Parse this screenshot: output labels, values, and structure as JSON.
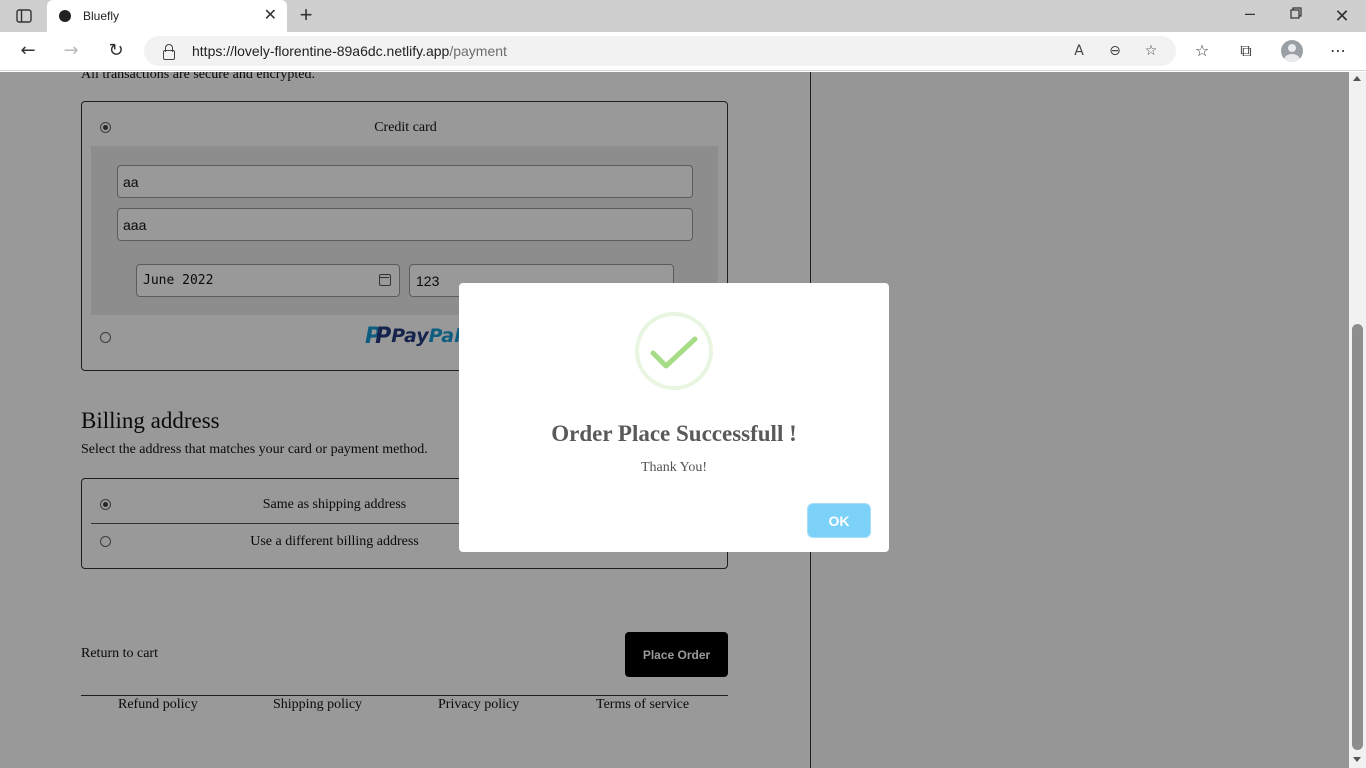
{
  "browser": {
    "tab_title": "Bluefly",
    "tab_close": "✕",
    "new_tab": "+",
    "url_host": "https://lovely-florentine-89a6dc.netlify.app",
    "url_path": "/payment"
  },
  "payment": {
    "secure_note": "All transactions are secure and encrypted.",
    "credit_card_label": "Credit card",
    "card_number": "aa",
    "name_on_card": "aaa",
    "expiry": "June 2022",
    "cvv": "123",
    "paypal_text_1": "Pay",
    "paypal_text_2": "Pal"
  },
  "billing": {
    "title": "Billing address",
    "description": "Select the address that matches your card or payment method.",
    "options": [
      {
        "label": "Same as shipping address",
        "selected": true
      },
      {
        "label": "Use a different billing address",
        "selected": false
      }
    ]
  },
  "actions": {
    "return_link": "Return to cart",
    "place_order": "Place Order"
  },
  "footer": {
    "links": [
      "Refund policy",
      "Shipping policy",
      "Privacy policy",
      "Terms of service"
    ]
  },
  "modal": {
    "title": "Order Place Successfull !",
    "text": "Thank You!",
    "ok_label": "OK"
  },
  "colors": {
    "success_green": "#a5dc86",
    "ok_blue": "#7cd1f9",
    "place_order_bg": "#000000"
  }
}
